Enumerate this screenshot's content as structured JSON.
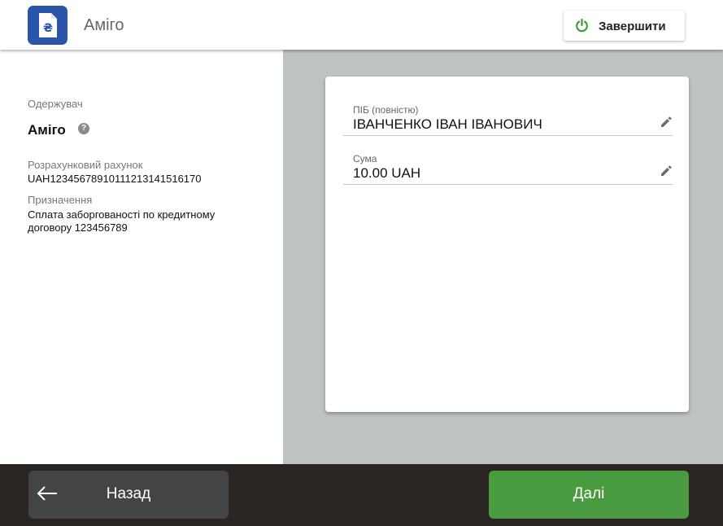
{
  "header": {
    "app_title": "Аміго",
    "logo_icon": "document-hryvnia-icon",
    "finish_label": "Завершити",
    "finish_icon": "power-icon"
  },
  "recipient": {
    "section_label": "Одержувач",
    "name": "Аміго",
    "help_icon": "question-icon",
    "account_label": "Розрахунковий рахунок",
    "account_value": "UAH1234567891011121314151617​0",
    "purpose_label": "Призначення",
    "purpose_value_line1": "Сплата заборгованості по кредитному",
    "purpose_value_line2": "договору 123456789"
  },
  "form": {
    "name_field": {
      "label": "ПІБ (повністю)",
      "value": "ІВАНЧЕНКО ІВАН ІВАНОВИЧ",
      "edit_icon": "pencil-icon"
    },
    "amount_field": {
      "label": "Сума",
      "value": "10.00 UAH",
      "edit_icon": "pencil-icon"
    }
  },
  "footer": {
    "back_label": "Назад",
    "back_icon": "arrow-left-icon",
    "next_label": "Далі"
  },
  "colors": {
    "brand_blue": "#2b55a8",
    "accent_green": "#4a9a40",
    "footer_bg": "#2a2523",
    "right_panel_bg": "#bec3c0",
    "back_button_bg": "#444444"
  }
}
